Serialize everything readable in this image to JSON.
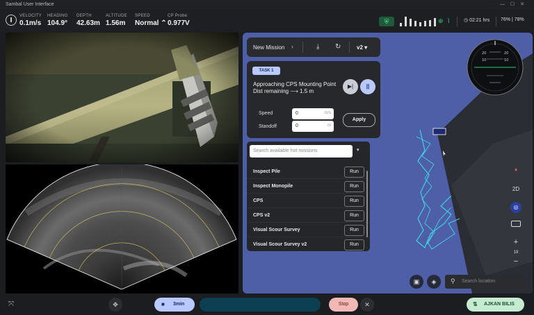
{
  "app": {
    "title": "Sambal User Interface"
  },
  "telemetry": [
    {
      "label": "VELOCITY",
      "value": "0.1m/s"
    },
    {
      "label": "HEADING",
      "value": "104.9°"
    },
    {
      "label": "DEPTH",
      "value": "42.63m"
    },
    {
      "label": "ALTITUDE",
      "value": "1.56m"
    },
    {
      "label": "SPEED",
      "value": "Normal ⌃"
    },
    {
      "label": "CP Probe",
      "value": "0.977V"
    }
  ],
  "status": {
    "time": "02:21 hrs",
    "battery": "76% | 78%"
  },
  "mission": {
    "title": "New Mission",
    "version": "v2"
  },
  "task": {
    "badge": "TASK 1",
    "name": "Approaching CPS Mounting Point",
    "distance": "Dist remaining ⟶ 1.5 m",
    "speed_label": "Speed",
    "speed_value": "0",
    "speed_unit": "m/s",
    "standoff_label": "Standoff",
    "standoff_value": "0",
    "standoff_unit": "m",
    "apply_label": "Apply"
  },
  "hot_missions": {
    "placeholder": "Search available hot missions",
    "run_label": "Run",
    "items": [
      {
        "name": "Inspect Pile"
      },
      {
        "name": "Inspect Monopile"
      },
      {
        "name": "CPS"
      },
      {
        "name": "CPS v2"
      },
      {
        "name": "Visual Scour Survey"
      },
      {
        "name": "Visual Scour Survey v2"
      }
    ]
  },
  "map": {
    "mode": "2D",
    "zoom": "19",
    "search_placeholder": "Search location",
    "compass": {
      "ticks": [
        "10",
        "20",
        "10",
        "20"
      ]
    }
  },
  "bottom": {
    "record_label": "3min",
    "stop_label": "Stop",
    "user_label": "AJKAN BILIS"
  },
  "colors": {
    "accent": "#b9c8ff",
    "stop": "#f2b8b5",
    "user": "#c5ecd0",
    "map": "#4e5fa7",
    "track": "#3fd1e6"
  }
}
